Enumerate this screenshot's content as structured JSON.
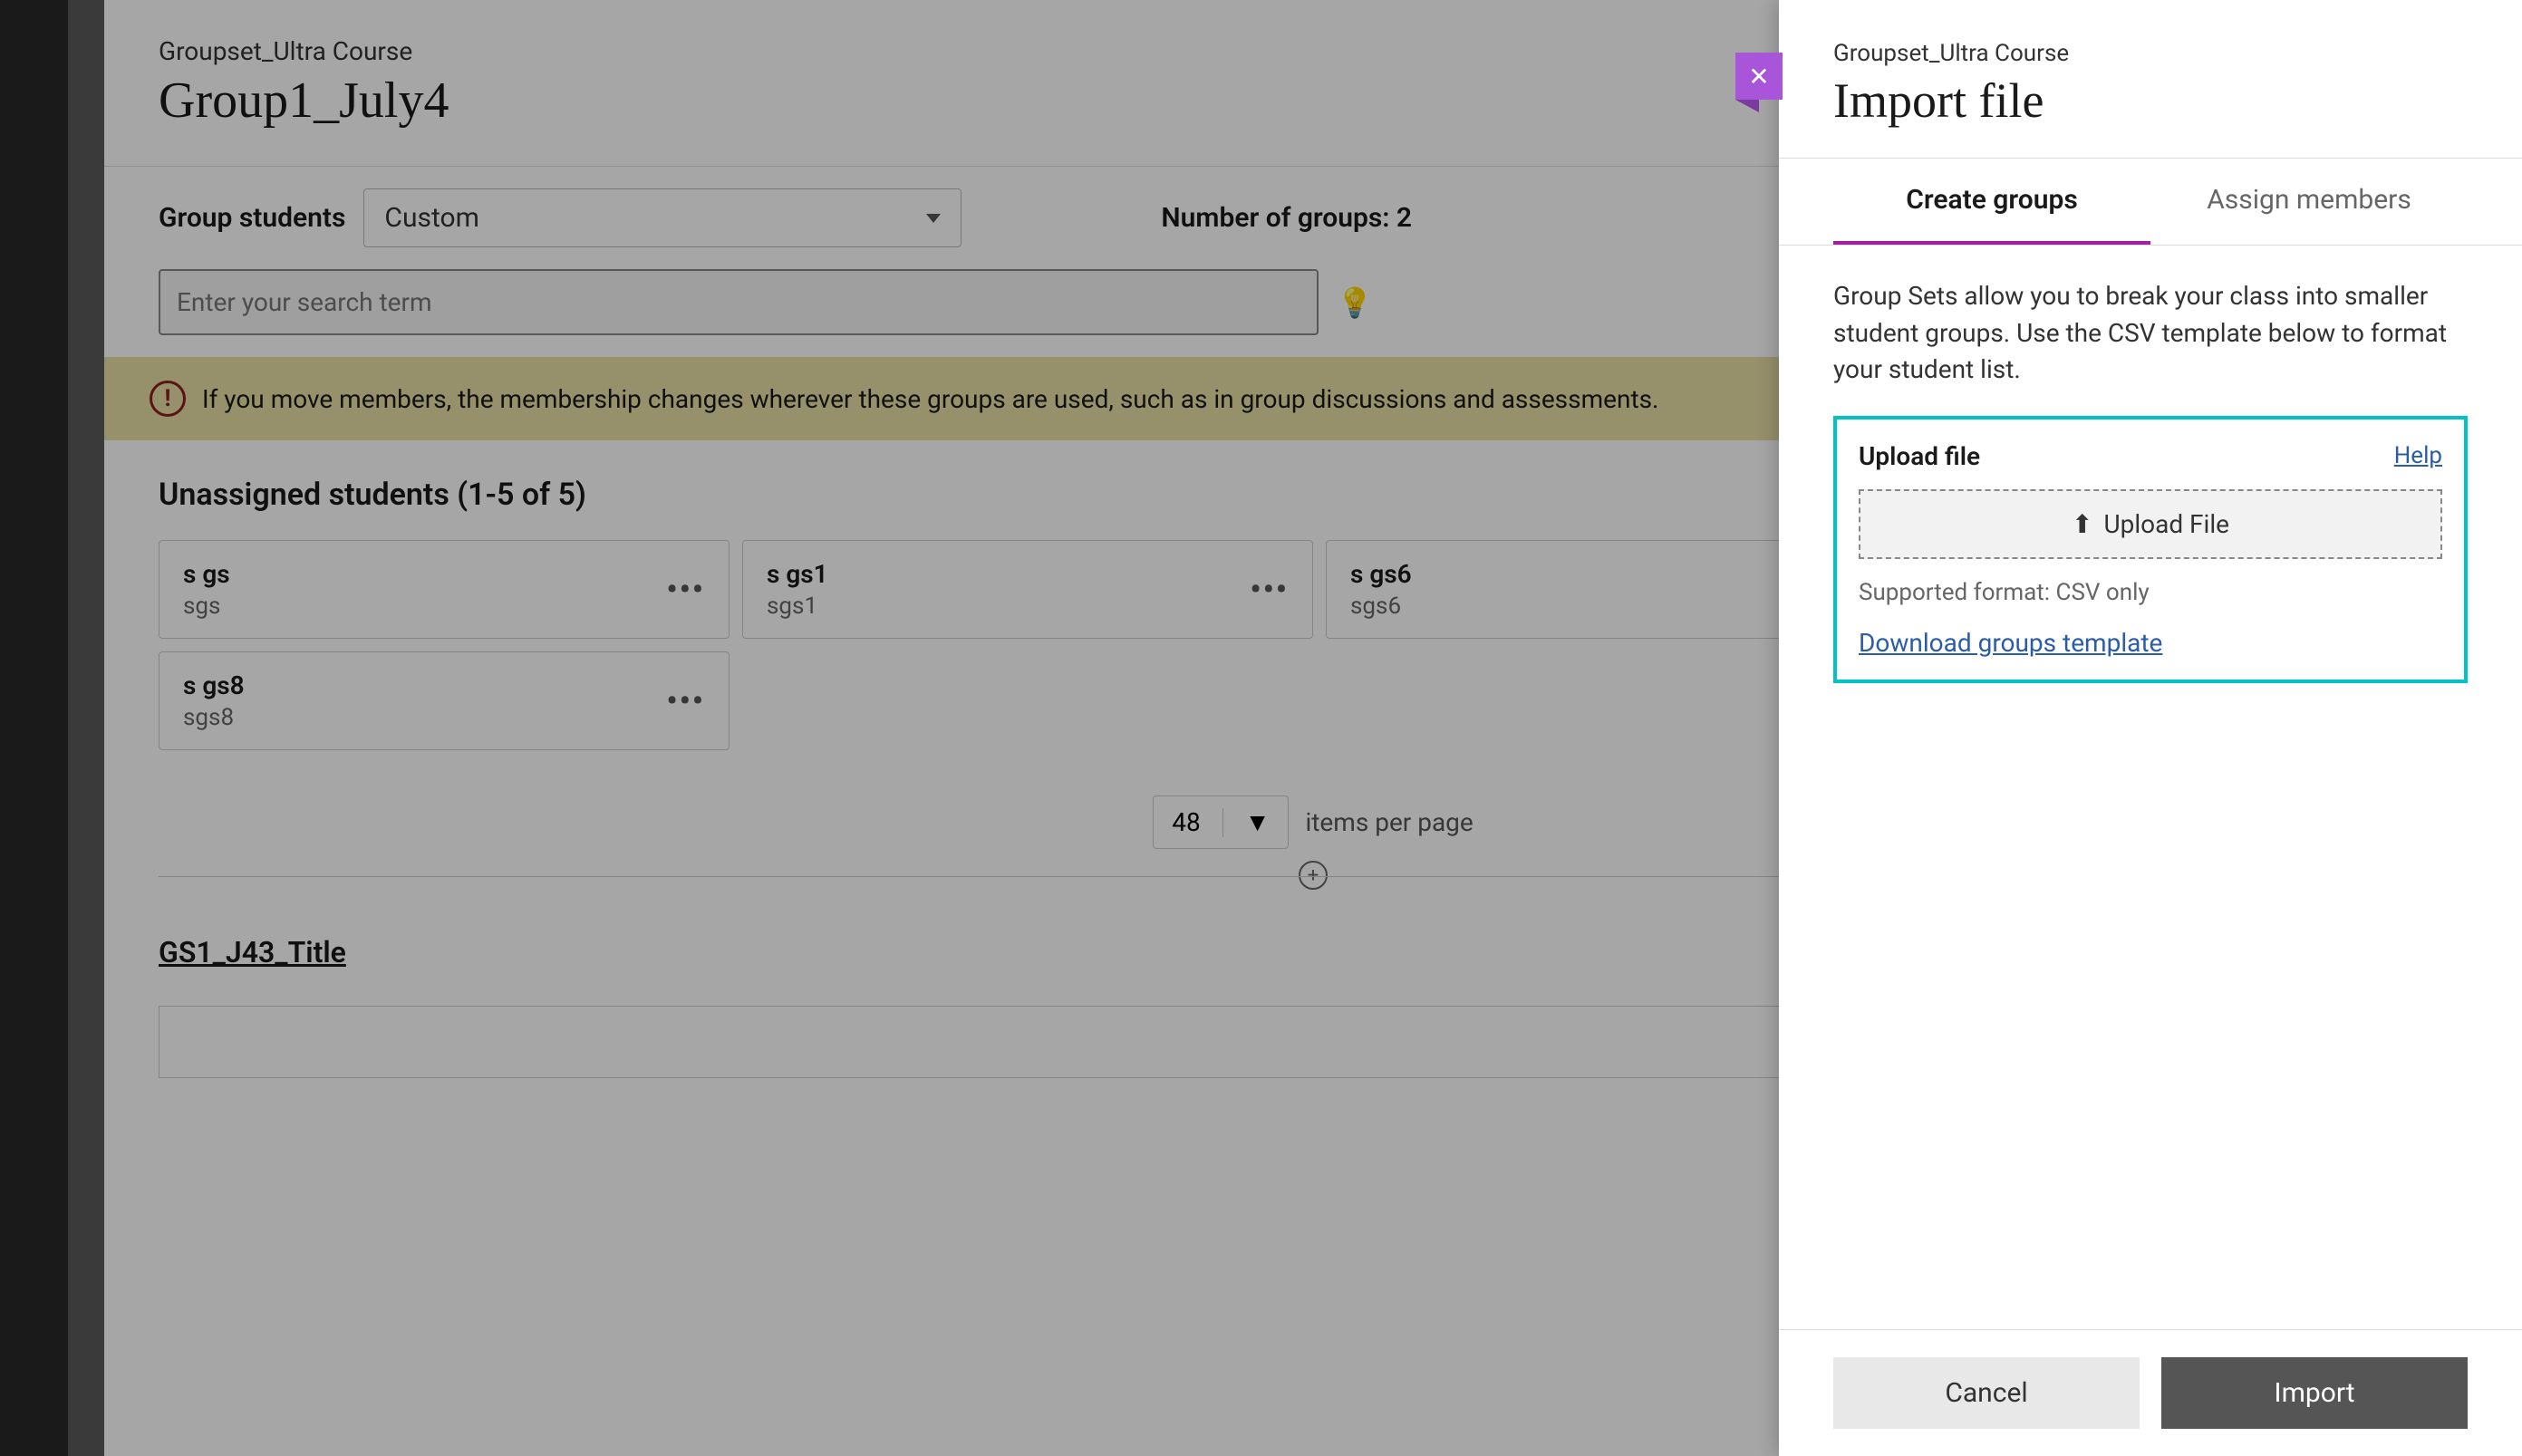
{
  "main": {
    "breadcrumb": "Groupset_Ultra Course",
    "title": "Group1_July4",
    "group_students_label": "Group students",
    "group_students_value": "Custom",
    "number_of_groups_label": "Number of groups: 2",
    "search_placeholder": "Enter your search term",
    "warning_text": "If you move members, the membership changes wherever these groups are used, such as in group discussions and assessments.",
    "unassigned_heading": "Unassigned students  (1-5 of 5)",
    "students": [
      {
        "name": "s gs",
        "username": "sgs"
      },
      {
        "name": "s gs1",
        "username": "sgs1"
      },
      {
        "name": "s gs6",
        "username": "sgs6"
      },
      {
        "name": "s gs8",
        "username": "sgs8"
      }
    ],
    "items_per_page_value": "48",
    "items_per_page_label": "items per page",
    "group_title": "GS1_J43_Title"
  },
  "drawer": {
    "breadcrumb": "Groupset_Ultra Course",
    "title": "Import file",
    "tabs": {
      "create": "Create groups",
      "assign": "Assign members"
    },
    "description": "Group Sets allow you to break your class into smaller student groups. Use the CSV template below to format your student list.",
    "upload_label": "Upload file",
    "help_label": "Help",
    "upload_button": "Upload File",
    "supported_format": "Supported format: CSV only",
    "download_template": "Download groups template",
    "cancel": "Cancel",
    "import": "Import"
  }
}
